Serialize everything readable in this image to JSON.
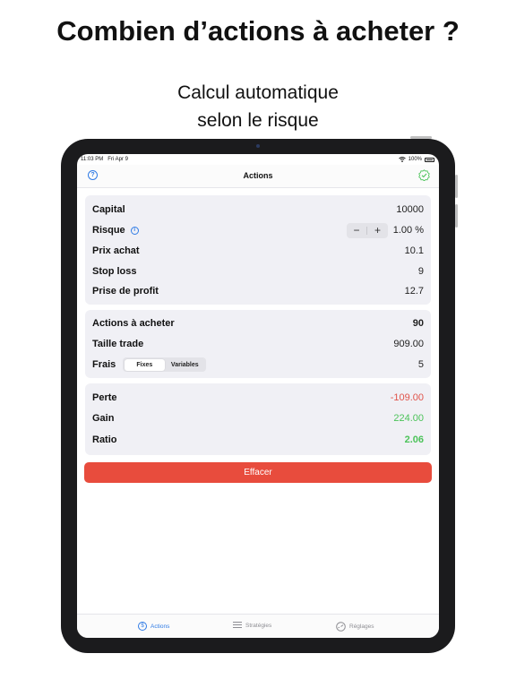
{
  "promo": {
    "headline": "Combien d’actions à acheter ?",
    "subline_1": "Calcul automatique",
    "subline_2": "selon le risque"
  },
  "status_bar": {
    "time": "11:03 PM",
    "date": "Fri Apr 9",
    "battery": "100%"
  },
  "nav": {
    "title": "Actions",
    "help_icon": "question-circle-icon",
    "right_icon": "check-seal-icon"
  },
  "inputs": {
    "capital_label": "Capital",
    "capital_value": "10000",
    "risk_label": "Risque",
    "risk_value": "1.00 %",
    "stepper_minus": "−",
    "stepper_plus": "+",
    "buy_label": "Prix achat",
    "buy_value": "10.1",
    "stop_label": "Stop loss",
    "stop_value": "9",
    "profit_label": "Prise de profit",
    "profit_value": "12.7"
  },
  "results": {
    "shares_label": "Actions à acheter",
    "shares_value": "90",
    "size_label": "Taille trade",
    "size_value": "909.00",
    "fees_label": "Frais",
    "fees_option_fixed": "Fixes",
    "fees_option_variable": "Variables",
    "fees_value": "5"
  },
  "outcome": {
    "loss_label": "Perte",
    "loss_value": "-109.00",
    "gain_label": "Gain",
    "gain_value": "224.00",
    "ratio_label": "Ratio",
    "ratio_value": "2.06"
  },
  "clear_button": "Effacer",
  "tabs": [
    {
      "label": "Actions",
      "icon": "dollar-circle-icon",
      "active": true
    },
    {
      "label": "Stratégies",
      "icon": "list-icon",
      "active": false
    },
    {
      "label": "Réglages",
      "icon": "gauge-icon",
      "active": false
    }
  ],
  "colors": {
    "accent": "#2f7be5",
    "destructive": "#e84c3d",
    "loss": "#e0534a",
    "gain": "#4cc35a"
  }
}
